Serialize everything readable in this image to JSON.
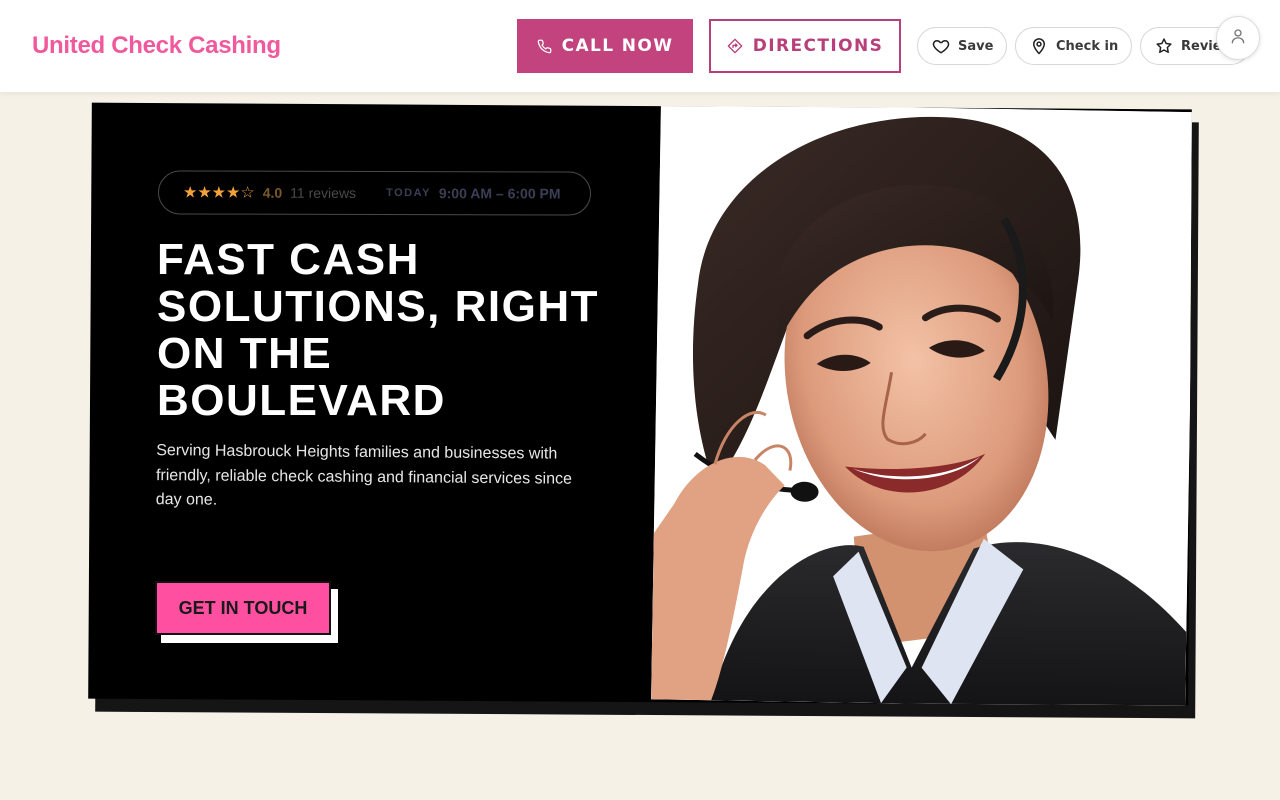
{
  "header": {
    "brand": "United Check Cashing",
    "call_label": "CALL NOW",
    "directions_label": "DIRECTIONS",
    "actions": {
      "save": "Save",
      "checkin": "Check in",
      "review": "Review"
    }
  },
  "hero": {
    "stars": "★★★★☆",
    "rating": "4.0",
    "reviews": "11 reviews",
    "today_label": "TODAY",
    "hours": "9:00 AM – 6:00 PM",
    "headline": "FAST CASH SOLUTIONS, RIGHT ON THE BOULEVARD",
    "subtext": "Serving Hasbrouck Heights families and businesses with friendly, reliable check cashing and financial services since day one.",
    "cta": "GET IN TOUCH"
  },
  "colors": {
    "brand": "#f05a9d",
    "primary_button": "#c2437d",
    "cta": "#ff4fa0",
    "hero_bg": "#000000",
    "page_bg": "#f6f1e7",
    "star": "#f2a23a"
  },
  "icons": {
    "call": "phone-icon",
    "directions": "directions-icon",
    "save": "heart-icon",
    "checkin": "location-pin-icon",
    "review": "star-icon",
    "account": "user-icon"
  }
}
